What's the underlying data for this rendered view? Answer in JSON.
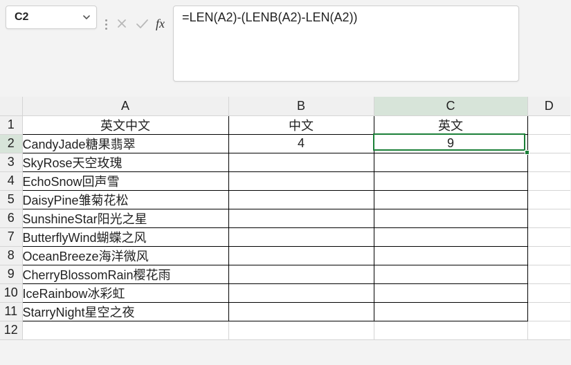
{
  "name_box": {
    "value": "C2"
  },
  "formula_bar": {
    "formula": "=LEN(A2)-(LENB(A2)-LEN(A2))"
  },
  "fx_label": "fx",
  "columns": [
    "A",
    "B",
    "C",
    "D"
  ],
  "row_headers": [
    "1",
    "2",
    "3",
    "4",
    "5",
    "6",
    "7",
    "8",
    "9",
    "10",
    "11",
    "12"
  ],
  "headers": {
    "a": "英文中文",
    "b": "中文",
    "c": "英文"
  },
  "rows": [
    {
      "a": "CandyJade糖果翡翠",
      "b": "4",
      "c": "9"
    },
    {
      "a": "SkyRose天空玫瑰",
      "b": "",
      "c": ""
    },
    {
      "a": "EchoSnow回声雪",
      "b": "",
      "c": ""
    },
    {
      "a": "DaisyPine雏菊花松",
      "b": "",
      "c": ""
    },
    {
      "a": "SunshineStar阳光之星",
      "b": "",
      "c": ""
    },
    {
      "a": "ButterflyWind蝴蝶之风",
      "b": "",
      "c": ""
    },
    {
      "a": "OceanBreeze海洋微风",
      "b": "",
      "c": ""
    },
    {
      "a": "CherryBlossomRain樱花雨",
      "b": "",
      "c": ""
    },
    {
      "a": "IceRainbow冰彩虹",
      "b": "",
      "c": ""
    },
    {
      "a": "StarryNight星空之夜",
      "b": "",
      "c": ""
    }
  ],
  "selected_cell": "C2"
}
